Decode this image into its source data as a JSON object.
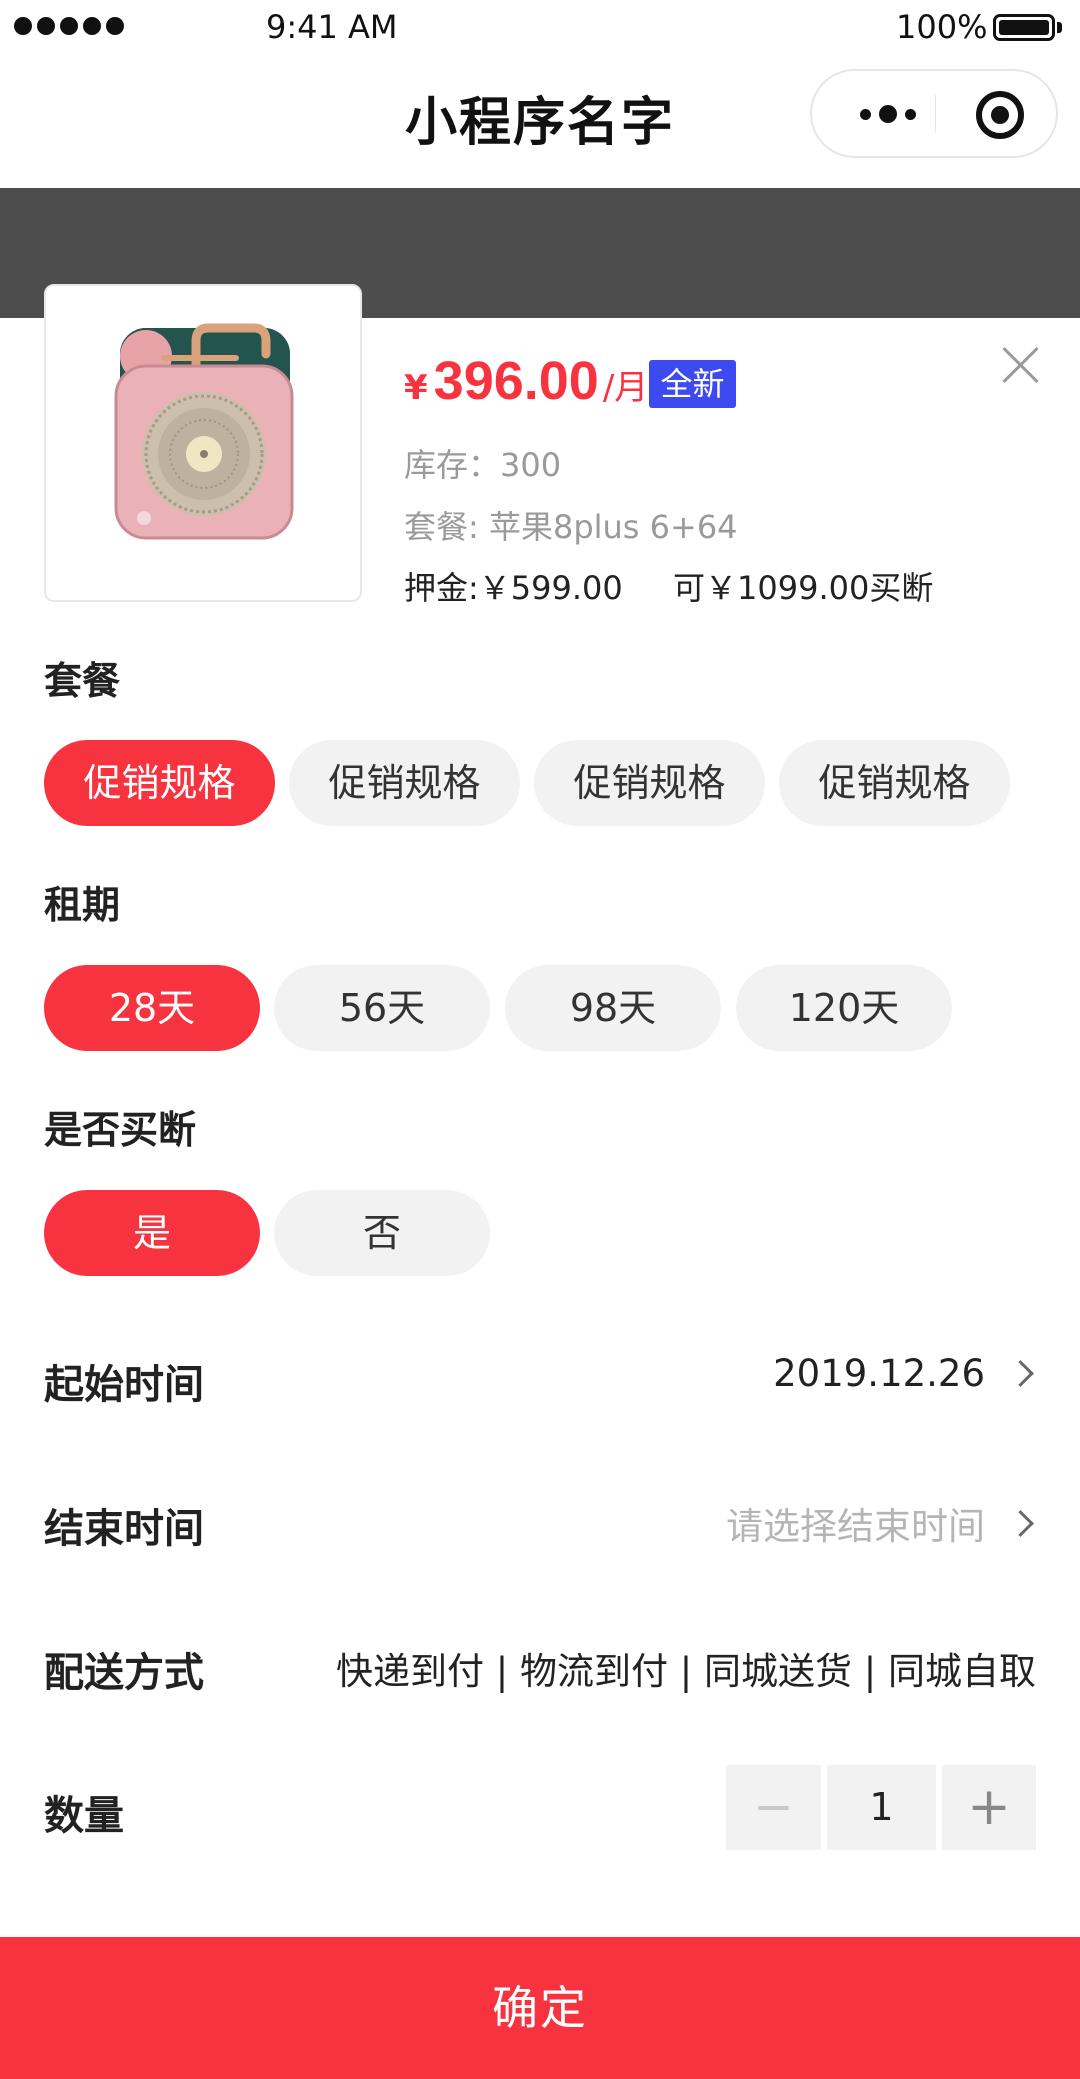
{
  "status_bar": {
    "time": "9:41 AM",
    "battery": "100%"
  },
  "nav": {
    "title": "小程序名字",
    "more_icon": "more-dots-icon",
    "target_icon": "target-icon"
  },
  "product": {
    "image_icon": "speaker-product-image",
    "currency": "¥",
    "price": "396.00",
    "unit": "/月",
    "badge": "全新",
    "stock": "库存：300",
    "package": "套餐: 苹果8plus 6+64",
    "deposit": "押金:￥599.00",
    "buyout": "可￥1099.00买断"
  },
  "sections": {
    "package": {
      "title": "套餐",
      "options": [
        "促销规格",
        "促销规格",
        "促销规格",
        "促销规格"
      ],
      "selected": 0
    },
    "term": {
      "title": "租期",
      "options": [
        "28天",
        "56天",
        "98天",
        "120天"
      ],
      "selected": 0
    },
    "buyout": {
      "title": "是否买断",
      "options": [
        "是",
        "否"
      ],
      "selected": 0
    }
  },
  "rows": {
    "start": {
      "label": "起始时间",
      "value": "2019.12.26"
    },
    "end": {
      "label": "结束时间",
      "placeholder": "请选择结束时间"
    },
    "delivery": {
      "label": "配送方式",
      "value": "快递到付 | 物流到付 | 同城送货 | 同城自取"
    },
    "quantity": {
      "label": "数量",
      "value": "1",
      "minus": "−",
      "plus": "+"
    }
  },
  "confirm_label": "确定",
  "colors": {
    "accent": "#f7333f",
    "badge": "#3c4af0",
    "band": "#4d4d4d"
  }
}
